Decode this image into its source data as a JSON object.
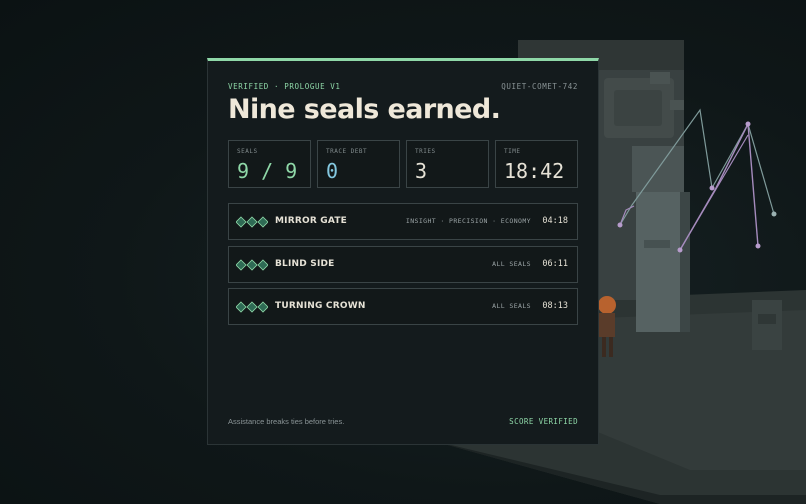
{
  "header": {
    "status": "VERIFIED · PROLOGUE V1",
    "player": "QUIET-COMET-742",
    "title": "Nine seals earned."
  },
  "stats": [
    {
      "label": "SEALS",
      "value": "9 / 9"
    },
    {
      "label": "TRACE DEBT",
      "value": "0"
    },
    {
      "label": "TRIES",
      "value": "3"
    },
    {
      "label": "TIME",
      "value": "18:42"
    }
  ],
  "levels": [
    {
      "name": "MIRROR GATE",
      "tags": "INSIGHT · PRECISION · ECONOMY",
      "time": "04:18",
      "seals_earned": 3,
      "seals_total": 3
    },
    {
      "name": "BLIND SIDE",
      "tags": "ALL SEALS",
      "time": "06:11",
      "seals_earned": 3,
      "seals_total": 3
    },
    {
      "name": "TURNING CROWN",
      "tags": "ALL SEALS",
      "time": "08:13",
      "seals_earned": 3,
      "seals_total": 3
    }
  ],
  "footer": {
    "note": "Assistance breaks ties before tries.",
    "verified": "SCORE VERIFIED"
  },
  "colors": {
    "accent": "#8fd8a8",
    "trace": "#84c8e0",
    "card_bg": "#141b1d",
    "page_bg": "#0f1819"
  }
}
